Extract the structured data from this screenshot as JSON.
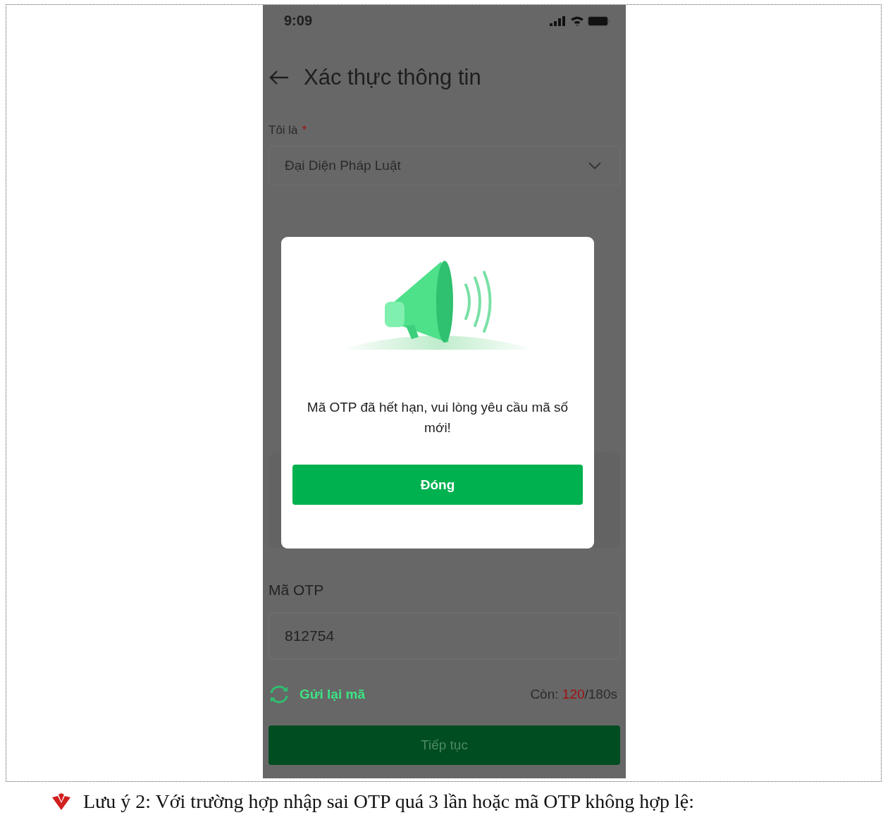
{
  "status_bar": {
    "time": "9:09"
  },
  "header": {
    "title": "Xác thực thông tin"
  },
  "role_field": {
    "label": "Tôi là",
    "required_mark": "*",
    "value": "Đại Diện Pháp Luật"
  },
  "dialog": {
    "message": "Mã OTP đã hết hạn, vui lòng yêu cầu mã số mới!",
    "button": "Đóng"
  },
  "otp_field": {
    "label": "Mã OTP",
    "value": "812754"
  },
  "resend": {
    "label": "Gửi lại mã"
  },
  "countdown": {
    "prefix": "Còn:",
    "remaining": "120",
    "total": "/180s"
  },
  "continue_button": {
    "label": "Tiếp tục"
  },
  "note": {
    "text": "Lưu ý 2: Với trường hợp nhập sai OTP quá 3 lần hoặc mã OTP không hợp lệ:"
  }
}
